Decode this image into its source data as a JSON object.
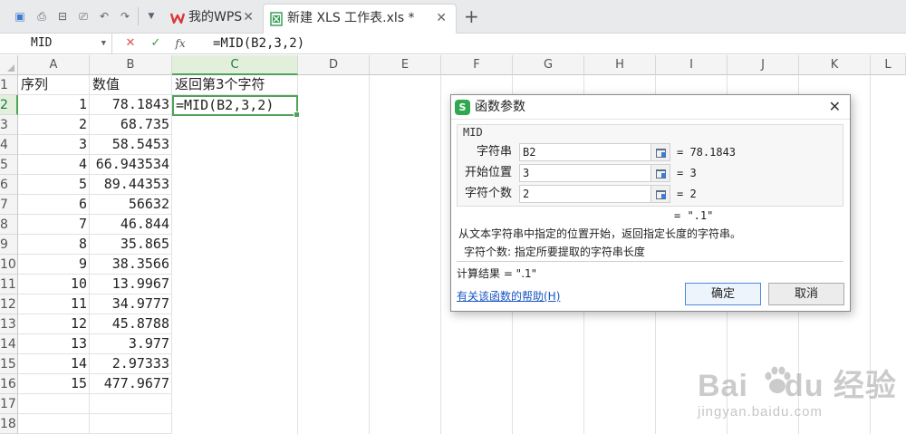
{
  "tabs": [
    {
      "label": "我的WPS"
    },
    {
      "label": "新建 XLS 工作表.xls *"
    }
  ],
  "formula_bar": {
    "name_box": "MID",
    "cancel_icon": "✕",
    "enter_icon": "✓",
    "fx_label": "fx",
    "formula": "=MID(B2,3,2)"
  },
  "columns": [
    "A",
    "B",
    "C",
    "D",
    "E",
    "F",
    "G",
    "H",
    "I",
    "J",
    "K",
    "L"
  ],
  "rows": [
    "1",
    "2",
    "3",
    "4",
    "5",
    "6",
    "7",
    "8",
    "9",
    "10",
    "11",
    "12",
    "13",
    "14",
    "15",
    "16",
    "17",
    "18"
  ],
  "header_row": {
    "a": "序列",
    "b": "数值",
    "c": "返回第3个字符"
  },
  "table": [
    {
      "a": "1",
      "b": "78.1843"
    },
    {
      "a": "2",
      "b": "68.735"
    },
    {
      "a": "3",
      "b": "58.5453"
    },
    {
      "a": "4",
      "b": "66.943534"
    },
    {
      "a": "5",
      "b": "89.44353"
    },
    {
      "a": "6",
      "b": "56632"
    },
    {
      "a": "7",
      "b": "46.844"
    },
    {
      "a": "8",
      "b": "35.865"
    },
    {
      "a": "9",
      "b": "38.3566"
    },
    {
      "a": "10",
      "b": "13.9967"
    },
    {
      "a": "11",
      "b": "34.9777"
    },
    {
      "a": "12",
      "b": "45.8788"
    },
    {
      "a": "13",
      "b": "3.977"
    },
    {
      "a": "14",
      "b": "2.97333"
    },
    {
      "a": "15",
      "b": "477.9677"
    }
  ],
  "active_cell": {
    "value": "=MID(B2,3,2)"
  },
  "dialog": {
    "title": "函数参数",
    "close": "✕",
    "function_name": "MID",
    "args": [
      {
        "label": "字符串",
        "value": "B2",
        "result": "= 78.1843"
      },
      {
        "label": "开始位置",
        "value": "3",
        "result": "= 3"
      },
      {
        "label": "字符个数",
        "value": "2",
        "result": "= 2"
      }
    ],
    "function_result": "= \".1\"",
    "description": "从文本字符串中指定的位置开始，返回指定长度的字符串。",
    "arg_description": "字符个数: 指定所要提取的字符串长度",
    "calc_result": "计算结果 = \".1\"",
    "help_link": "有关该函数的帮助(H)",
    "ok": "确定",
    "cancel": "取消"
  },
  "watermark": {
    "brand": "Bai du 经验",
    "url": "jingyan.baidu.com"
  },
  "colors": {
    "accent_green": "#4ea35b",
    "link_blue": "#1a55c4",
    "wps_red": "#d93a3a"
  }
}
